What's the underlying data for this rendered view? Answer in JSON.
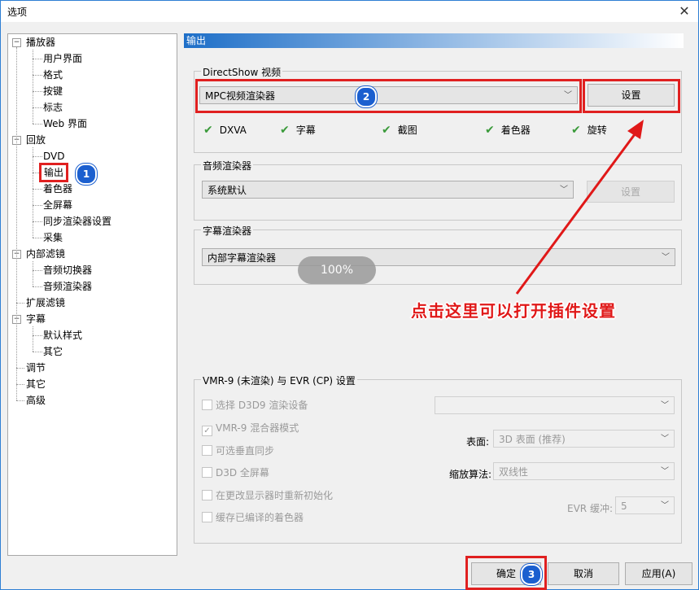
{
  "window": {
    "title": "选项",
    "close_glyph": "✕"
  },
  "tree": {
    "items": [
      {
        "label": "播放器",
        "level": 0,
        "expander": "−"
      },
      {
        "label": "用户界面",
        "level": 1
      },
      {
        "label": "格式",
        "level": 1
      },
      {
        "label": "按键",
        "level": 1
      },
      {
        "label": "标志",
        "level": 1
      },
      {
        "label": "Web 界面",
        "level": 1
      },
      {
        "label": "回放",
        "level": 0,
        "expander": "−"
      },
      {
        "label": "DVD",
        "level": 1
      },
      {
        "label": "输出",
        "level": 1,
        "selected": true
      },
      {
        "label": "着色器",
        "level": 1
      },
      {
        "label": "全屏幕",
        "level": 1
      },
      {
        "label": "同步渲染器设置",
        "level": 1
      },
      {
        "label": "采集",
        "level": 1
      },
      {
        "label": "内部滤镜",
        "level": 0,
        "expander": "−"
      },
      {
        "label": "音频切换器",
        "level": 1
      },
      {
        "label": "音频渲染器",
        "level": 1
      },
      {
        "label": "扩展滤镜",
        "level": 0
      },
      {
        "label": "字幕",
        "level": 0,
        "expander": "−"
      },
      {
        "label": "默认样式",
        "level": 1
      },
      {
        "label": "其它",
        "level": 1
      },
      {
        "label": "调节",
        "level": 0
      },
      {
        "label": "其它",
        "level": 0
      },
      {
        "label": "高级",
        "level": 0
      }
    ]
  },
  "panel": {
    "header": "输出",
    "directshow": {
      "group_label": "DirectShow 视频",
      "renderer_value": "MPC视频渲染器",
      "settings_label": "设置",
      "capabilities": [
        "DXVA",
        "字幕",
        "截图",
        "着色器",
        "旋转"
      ]
    },
    "audio": {
      "group_label": "音频渲染器",
      "renderer_value": "系统默认",
      "settings_label": "设置"
    },
    "subtitle": {
      "group_label": "字幕渲染器",
      "renderer_value": "内部字幕渲染器"
    },
    "vmr": {
      "group_label": "VMR-9 (未渲染) 与 EVR (CP) 设置",
      "options": [
        {
          "label": "选择 D3D9 渲染设备",
          "checked": false
        },
        {
          "label": "VMR-9 混合器模式",
          "checked": true
        },
        {
          "label": "可选垂直同步",
          "checked": false
        },
        {
          "label": "D3D 全屏幕",
          "checked": false
        },
        {
          "label": "在更改显示器时重新初始化",
          "checked": false
        },
        {
          "label": "缓存已编译的着色器",
          "checked": false
        }
      ],
      "surface_label": "表面:",
      "surface_value": "3D 表面 (推荐)",
      "resize_label": "缩放算法:",
      "resize_value": "双线性",
      "evr_buffer_label": "EVR 缓冲:",
      "evr_buffer_value": "5",
      "device_value": ""
    }
  },
  "overlay": {
    "zoom_text": "100%",
    "annotation": "点击这里可以打开插件设置",
    "badges": [
      "1",
      "2",
      "3"
    ],
    "accent_color": "#e02020",
    "badge_color": "#1b5fcf"
  },
  "buttons": {
    "ok": "确定",
    "cancel": "取消",
    "apply": "应用(A)"
  }
}
